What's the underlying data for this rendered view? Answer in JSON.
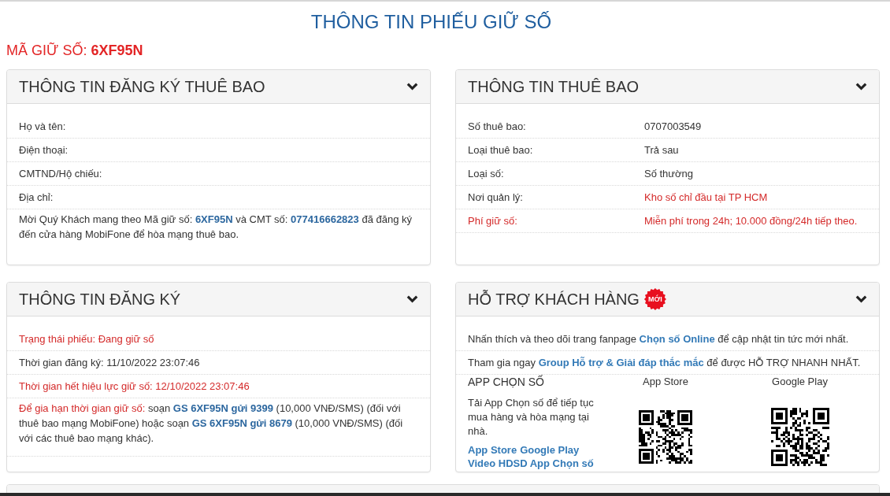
{
  "page_title": "THÔNG TIN PHIẾU GIỮ SỐ",
  "hold_code": {
    "label": "MÃ GIỮ SỐ:",
    "value": "6XF95N"
  },
  "registration_subscriber": {
    "title": "THÔNG TIN ĐĂNG KÝ THUÊ BAO",
    "fields": [
      "Họ và tên:",
      "Điện thoại:",
      "CMTND/Hộ chiếu:",
      "Địa chỉ:"
    ],
    "note": "Mời Quý Khách mang theo Mã giữ số: **6XF95N** và CMT số: **077416662823** đã đăng ký đến cửa hàng MobiFone để hòa mạng thuê bao."
  },
  "subscriber": {
    "title": "THÔNG TIN THUÊ BAO",
    "rows": [
      {
        "label": "Số thuê bao:",
        "value": "0707003549",
        "label_warning": false,
        "value_warning": false
      },
      {
        "label": "Loại thuê bao:",
        "value": "Trả sau",
        "label_warning": false,
        "value_warning": false
      },
      {
        "label": "Loại số:",
        "value": "Số thường",
        "label_warning": false,
        "value_warning": false
      },
      {
        "label": "Nơi quản lý:",
        "value": "Kho số chỉ đầu tại TP HCM",
        "label_warning": false,
        "value_warning": true
      },
      {
        "label": "Phí giữ số:",
        "value": "Miễn phí trong 24h; 10.000 đồng/24h tiếp theo.",
        "label_warning": true,
        "value_warning": true
      }
    ]
  },
  "registration": {
    "title": "THÔNG TIN ĐĂNG KÝ",
    "rows": [
      {
        "text": "Trạng thái phiếu: Đang giữ số",
        "warning": true
      },
      {
        "text": "Thời gian đăng ký: 11/10/2022 23:07:46",
        "warning": false
      },
      {
        "text": "Thời gian hết hiệu lực giữ số: 12/10/2022 23:07:46",
        "warning": true
      }
    ],
    "renewal": {
      "lead": "Để gia hạn thời gian giữ số:",
      "text": "soạn **GS 6XF95N gửi 9399** (10,000 VNĐ/SMS) (đối với thuê bao mạng MobiFone) hoặc soạn **GS 6XF95N gửi 8679** (10,000 VNĐ/SMS) (đối với các thuê bao mạng khác)."
    }
  },
  "support": {
    "title": "HỖ TRỢ KHÁCH HÀNG",
    "badge": "MỚI",
    "lines": [
      {
        "before": "Nhấn thích và theo dõi trang fanpage",
        "link": "Chọn số Online",
        "after": "để cập nhật tin tức mới nhất."
      },
      {
        "before": "Tham gia ngay",
        "link": "Group Hỗ trợ & Giải đáp thắc mắc",
        "after": "để được HỖ TRỢ NHANH NHẤT."
      }
    ],
    "app": {
      "heading": "APP CHỌN SỐ",
      "description": "Tải App Chọn số để tiếp tục mua hàng và hòa mạng tại nhà.",
      "store_links": [
        "App Store",
        "Google Play"
      ],
      "video_link": "Video HDSD App Chọn số",
      "qr_codes": [
        {
          "label": "App Store"
        },
        {
          "label": "Google Play"
        }
      ]
    }
  }
}
